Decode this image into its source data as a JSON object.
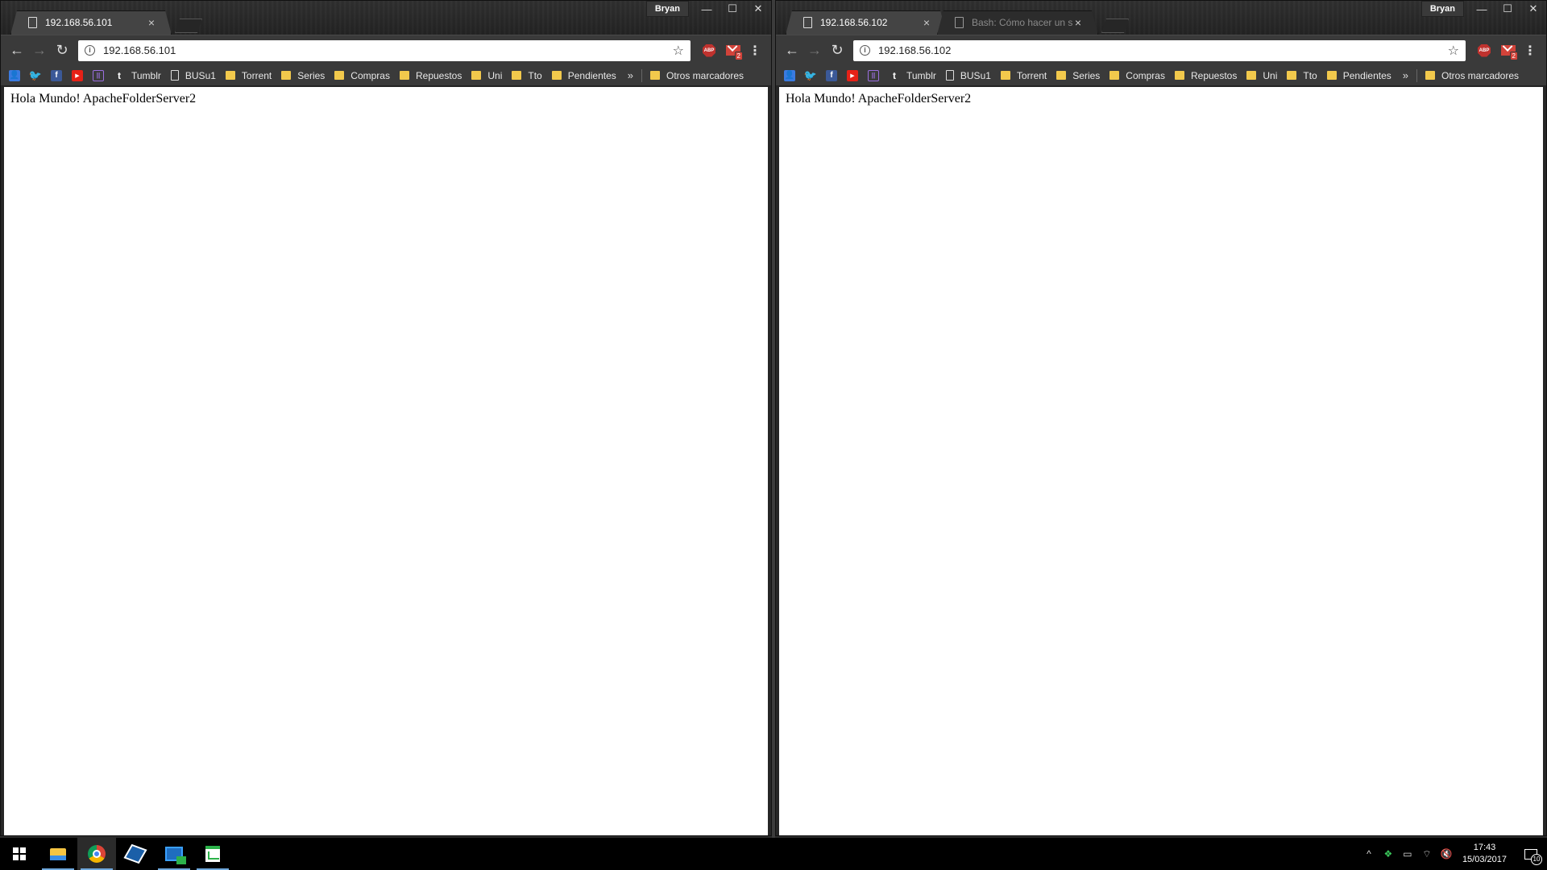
{
  "left_window": {
    "profile": "Bryan",
    "tabs": [
      {
        "title": "192.168.56.101",
        "state": "active"
      }
    ],
    "url": "192.168.56.101",
    "page_text": "Hola Mundo! ApacheFolderServer2"
  },
  "right_window": {
    "profile": "Bryan",
    "tabs": [
      {
        "title": "192.168.56.102",
        "state": "active"
      },
      {
        "title": "Bash: Cómo hacer un sc",
        "state": "inactive"
      }
    ],
    "url": "192.168.56.102",
    "page_text": "Hola Mundo! ApacheFolderServer2"
  },
  "controls": {
    "minimize": "—",
    "maximize": "☐",
    "close": "✕",
    "tab_close": "×"
  },
  "toolbar": {
    "back": "←",
    "forward": "→",
    "reload": "↻",
    "info": "i",
    "star": "☆",
    "abp": "ABP",
    "mail_badge": "2",
    "menu": "⋮"
  },
  "bookmarks": {
    "items": [
      {
        "label": "",
        "icon": "contacts-icon",
        "color": "#3b7be0"
      },
      {
        "label": "",
        "icon": "twitter-icon",
        "color": "#1da1f2"
      },
      {
        "label": "",
        "icon": "facebook-icon",
        "color": "#3b5998"
      },
      {
        "label": "",
        "icon": "youtube-icon",
        "color": "#e62117"
      },
      {
        "label": "",
        "icon": "twitch-icon",
        "color": "#6441a5"
      },
      {
        "label": "Tumblr",
        "icon": "tumblr-icon",
        "color": "#35465c"
      },
      {
        "label": "BUSu1",
        "icon": "document-icon"
      },
      {
        "label": "Torrent",
        "icon": "folder-icon"
      },
      {
        "label": "Series",
        "icon": "folder-icon"
      },
      {
        "label": "Compras",
        "icon": "folder-icon"
      },
      {
        "label": "Repuestos",
        "icon": "folder-icon"
      },
      {
        "label": "Uni",
        "icon": "folder-icon"
      },
      {
        "label": "Tto",
        "icon": "folder-icon"
      },
      {
        "label": "Pendientes",
        "icon": "folder-icon"
      }
    ],
    "more": "»",
    "other": "Otros marcadores"
  },
  "taskbar": {
    "apps": [
      {
        "name": "start",
        "icon": "windows-start-icon"
      },
      {
        "name": "file-explorer",
        "icon": "folder-icon"
      },
      {
        "name": "chrome",
        "icon": "chrome-icon"
      },
      {
        "name": "virtualbox",
        "icon": "virtualbox-icon"
      },
      {
        "name": "network",
        "icon": "network-icon"
      },
      {
        "name": "spreadsheet",
        "icon": "spreadsheet-icon"
      }
    ],
    "tray": {
      "chevron": "^",
      "dropbox": "❖",
      "battery": "▭",
      "wifi": "⌔",
      "volume": "🔇"
    },
    "time": "17:43",
    "date": "15/03/2017",
    "notifications": "10"
  }
}
